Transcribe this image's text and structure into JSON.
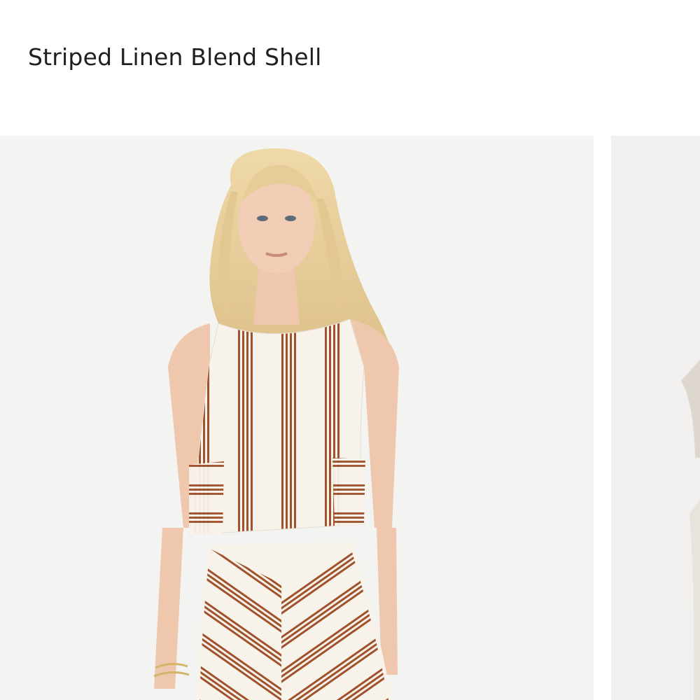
{
  "product": {
    "title": "Striped Linen Blend Shell"
  },
  "gallery": {
    "images": [
      {
        "alt": "Model wearing striped linen blend shell with matching striped skirt"
      },
      {
        "alt": "Striped Linen Blend Shell alternate view"
      }
    ]
  },
  "colors": {
    "background": "#ffffff",
    "photo_bg": "#f3f3f2",
    "stripe": "#a0522d",
    "fabric": "#f7f2ea",
    "hair": "#e8cf9a",
    "skin": "#eec7ad",
    "title_text": "#1f1f1f"
  }
}
